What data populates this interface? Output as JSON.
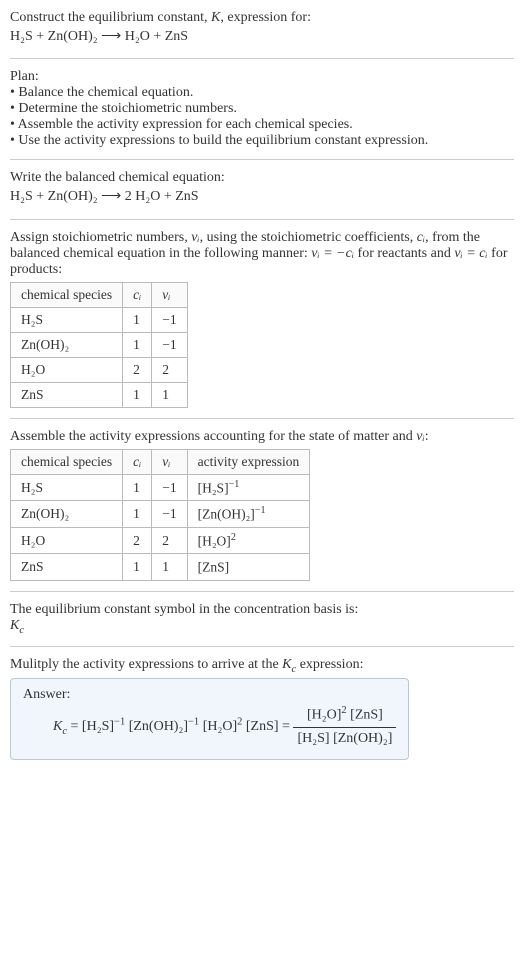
{
  "intro": {
    "line1_a": "Construct the equilibrium constant, ",
    "K": "K",
    "line1_b": ", expression for:",
    "equation": "H₂S + Zn(OH)₂ ⟶ H₂O + ZnS"
  },
  "plan": {
    "title": "Plan:",
    "b1": "• Balance the chemical equation.",
    "b2": "• Determine the stoichiometric numbers.",
    "b3": "• Assemble the activity expression for each chemical species.",
    "b4": "• Use the activity expressions to build the equilibrium constant expression."
  },
  "balanced": {
    "title": "Write the balanced chemical equation:",
    "equation": "H₂S + Zn(OH)₂ ⟶ 2 H₂O + ZnS"
  },
  "assign": {
    "text_a": "Assign stoichiometric numbers, ",
    "nu_i": "νᵢ",
    "text_b": ", using the stoichiometric coefficients, ",
    "c_i": "cᵢ",
    "text_c": ", from the balanced chemical equation in the following manner: ",
    "rel1": "νᵢ = −cᵢ",
    "text_d": " for reactants and ",
    "rel2": "νᵢ = cᵢ",
    "text_e": " for products:"
  },
  "table1": {
    "h1": "chemical species",
    "h2": "cᵢ",
    "h3": "νᵢ",
    "rows": [
      {
        "s": "H₂S",
        "c": "1",
        "v": "−1"
      },
      {
        "s": "Zn(OH)₂",
        "c": "1",
        "v": "−1"
      },
      {
        "s": "H₂O",
        "c": "2",
        "v": "2"
      },
      {
        "s": "ZnS",
        "c": "1",
        "v": "1"
      }
    ]
  },
  "assemble": {
    "text_a": "Assemble the activity expressions accounting for the state of matter and ",
    "nu_i": "νᵢ",
    "text_b": ":"
  },
  "table2": {
    "h1": "chemical species",
    "h2": "cᵢ",
    "h3": "νᵢ",
    "h4": "activity expression",
    "rows": [
      {
        "s": "H₂S",
        "c": "1",
        "v": "−1",
        "a_base": "[H₂S]",
        "a_exp": "−1"
      },
      {
        "s": "Zn(OH)₂",
        "c": "1",
        "v": "−1",
        "a_base": "[Zn(OH)₂]",
        "a_exp": "−1"
      },
      {
        "s": "H₂O",
        "c": "2",
        "v": "2",
        "a_base": "[H₂O]",
        "a_exp": "2"
      },
      {
        "s": "ZnS",
        "c": "1",
        "v": "1",
        "a_base": "[ZnS]",
        "a_exp": ""
      }
    ]
  },
  "symbol": {
    "line1": "The equilibrium constant symbol in the concentration basis is:",
    "Kc_pre": "K",
    "Kc_sub": "c"
  },
  "multiply": {
    "text_a": "Mulitply the activity expressions to arrive at the ",
    "Kc_pre": "K",
    "Kc_sub": "c",
    "text_b": " expression:"
  },
  "answer": {
    "label": "Answer:",
    "Kc_pre": "K",
    "Kc_sub": "c",
    "eq": " = ",
    "t1_base": "[H₂S]",
    "t1_exp": "−1",
    "t2_base": "[Zn(OH)₂]",
    "t2_exp": "−1",
    "t3_base": "[H₂O]",
    "t3_exp": "2",
    "t4_base": "[ZnS]",
    "eq2": " = ",
    "num_a_base": "[H₂O]",
    "num_a_exp": "2",
    "num_b": "[ZnS]",
    "den_a": "[H₂S]",
    "den_b": "[Zn(OH)₂]"
  },
  "chart_data": {
    "type": "table",
    "tables": [
      {
        "title": "Stoichiometric numbers",
        "columns": [
          "chemical species",
          "c_i",
          "nu_i"
        ],
        "rows": [
          [
            "H2S",
            1,
            -1
          ],
          [
            "Zn(OH)2",
            1,
            -1
          ],
          [
            "H2O",
            2,
            2
          ],
          [
            "ZnS",
            1,
            1
          ]
        ]
      },
      {
        "title": "Activity expressions",
        "columns": [
          "chemical species",
          "c_i",
          "nu_i",
          "activity expression"
        ],
        "rows": [
          [
            "H2S",
            1,
            -1,
            "[H2S]^-1"
          ],
          [
            "Zn(OH)2",
            1,
            -1,
            "[Zn(OH)2]^-1"
          ],
          [
            "H2O",
            2,
            2,
            "[H2O]^2"
          ],
          [
            "ZnS",
            1,
            1,
            "[ZnS]"
          ]
        ]
      }
    ]
  }
}
